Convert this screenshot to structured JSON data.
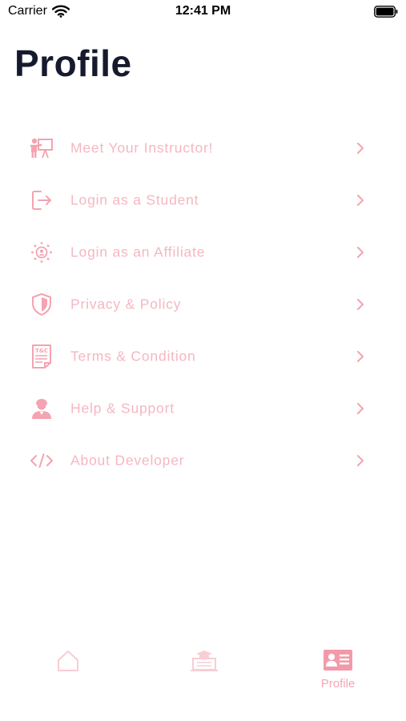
{
  "status_bar": {
    "carrier": "Carrier",
    "time": "12:41 PM"
  },
  "page": {
    "title": "Profile"
  },
  "menu": {
    "items": [
      {
        "label": "Meet Your Instructor!",
        "icon": "instructor-icon"
      },
      {
        "label": "Login as a Student",
        "icon": "login-icon"
      },
      {
        "label": "Login as an Affiliate",
        "icon": "affiliate-icon"
      },
      {
        "label": "Privacy & Policy",
        "icon": "shield-icon"
      },
      {
        "label": "Terms & Condition",
        "icon": "terms-document-icon"
      },
      {
        "label": "Help & Support",
        "icon": "support-agent-icon"
      },
      {
        "label": "About Developer",
        "icon": "code-icon"
      }
    ],
    "text_color": "#f5b7c1",
    "icon_color": "#f4a3b0"
  },
  "tab_bar": {
    "tabs": [
      {
        "name": "home",
        "icon": "home-icon",
        "label": ""
      },
      {
        "name": "courses",
        "icon": "courses-icon",
        "label": ""
      },
      {
        "name": "profile",
        "icon": "profile-card-icon",
        "label": "Profile",
        "active": true
      }
    ],
    "active_color": "#f29aaa",
    "inactive_color": "#f8cdd4"
  },
  "colors": {
    "title": "#161a2e",
    "background": "#ffffff"
  }
}
